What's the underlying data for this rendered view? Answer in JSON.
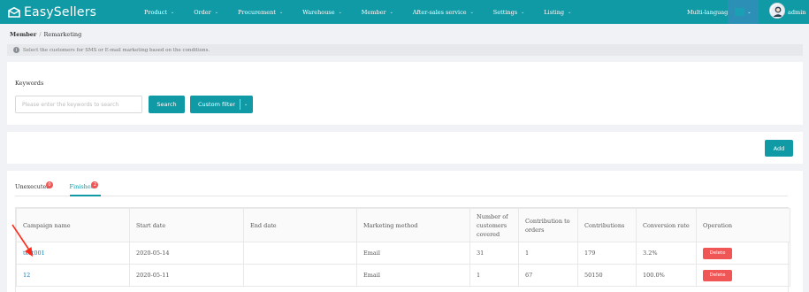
{
  "app": {
    "brand": "EasySellers",
    "language_label": "Multi-language",
    "user": "admin"
  },
  "nav": [
    {
      "label": "Product"
    },
    {
      "label": "Order"
    },
    {
      "label": "Procurement"
    },
    {
      "label": "Warehouse"
    },
    {
      "label": "Member"
    },
    {
      "label": "After-sales service"
    },
    {
      "label": "Settings"
    },
    {
      "label": "Listing"
    }
  ],
  "breadcrumb": {
    "parent": "Member",
    "current": "Remarketing"
  },
  "tip": "Select the customers for SMS or E-mail marketing based on the conditions.",
  "filter": {
    "keywords_label": "Keywords",
    "placeholder": "Please enter the keywords to search",
    "search_label": "Search",
    "custom_filter_label": "Custom filter"
  },
  "add_label": "Add",
  "tabs": [
    {
      "label": "Unexecuted",
      "count": "0",
      "active": false
    },
    {
      "label": "Finished",
      "count": "2",
      "active": true
    }
  ],
  "table": {
    "headers": [
      "Campaign name",
      "Start date",
      "End date",
      "Marketing method",
      "Number of customers covered",
      "Contribution to orders",
      "Contributions",
      "Conversion rate",
      "Operation"
    ],
    "rows": [
      {
        "name": "test001",
        "start": "2020-05-14",
        "end": "",
        "method": "Email",
        "covered": "31",
        "orders": "1",
        "contributions": "179",
        "rate": "3.2%",
        "op": "Delete"
      },
      {
        "name": "12",
        "start": "2020-05-11",
        "end": "",
        "method": "Email",
        "covered": "1",
        "orders": "67",
        "contributions": "50150",
        "rate": "100.0%",
        "op": "Delete"
      }
    ]
  },
  "colors": {
    "brand": "#0f9aa6",
    "danger": "#f05656",
    "link": "#0f7fb8"
  }
}
